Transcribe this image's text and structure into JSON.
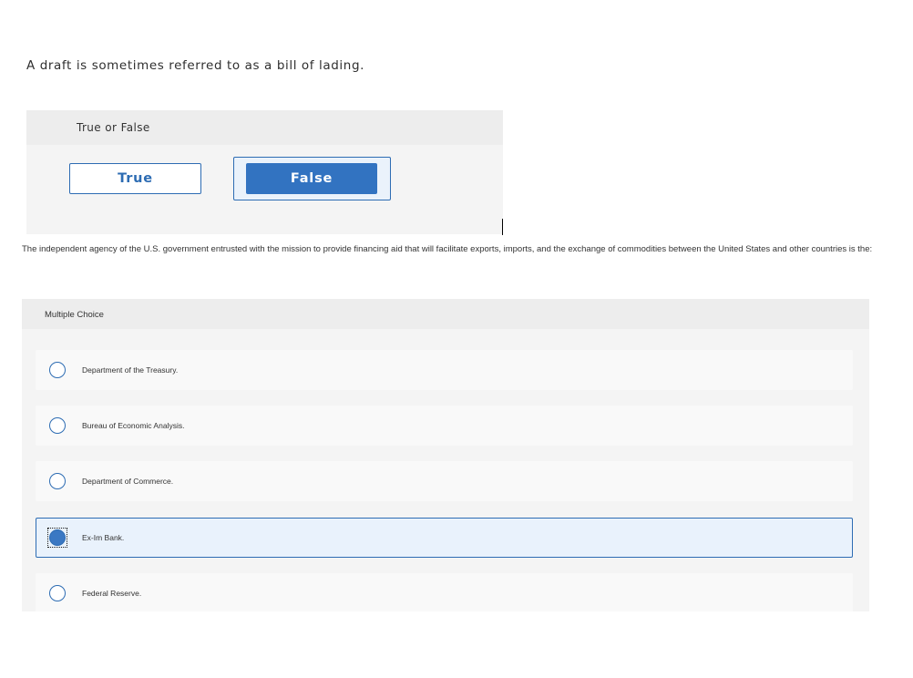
{
  "question1": {
    "prompt": "A draft is sometimes referred to as a bill of lading.",
    "type_label": "True or False",
    "options": [
      {
        "label": "True",
        "selected": false
      },
      {
        "label": "False",
        "selected": true
      }
    ]
  },
  "question2": {
    "prompt": "The independent agency of the U.S. government entrusted with the mission to provide financing aid that will facilitate exports, imports, and the exchange of commodities between the United States and other countries is the:",
    "type_label": "Multiple Choice",
    "options": [
      {
        "label": "Department of the Treasury.",
        "selected": false
      },
      {
        "label": "Bureau of Economic Analysis.",
        "selected": false
      },
      {
        "label": "Department of Commerce.",
        "selected": false
      },
      {
        "label": "Ex-Im Bank.",
        "selected": true
      },
      {
        "label": "Federal Reserve.",
        "selected": false
      }
    ]
  },
  "colors": {
    "accent": "#2d6cb3",
    "accent_fill": "#3273c1",
    "selected_bg": "#e9f2fc",
    "panel_bg": "#f4f4f4",
    "header_bg": "#ededed"
  },
  "icons": {
    "radio_unselected": "radio-empty-icon",
    "radio_selected": "radio-filled-icon"
  }
}
